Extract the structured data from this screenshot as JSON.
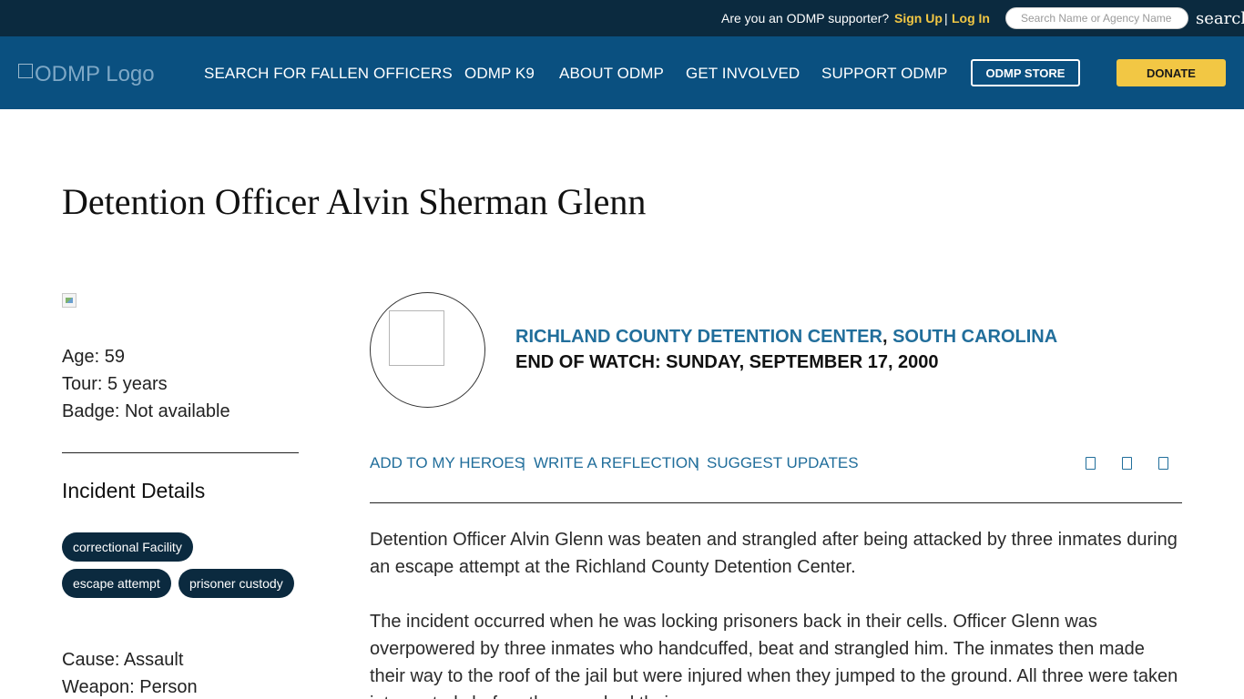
{
  "topbar": {
    "supporter_text": "Are you an ODMP supporter?",
    "signup_label": "Sign Up",
    "separator": "|",
    "login_label": "Log In",
    "search_placeholder": "Search Name or Agency Name",
    "search_button_label": "search"
  },
  "nav": {
    "logo_alt": "ODMP Logo",
    "items": [
      {
        "label": "SEARCH FOR FALLEN OFFICERS"
      },
      {
        "label": "ODMP K9"
      },
      {
        "label": "ABOUT ODMP"
      },
      {
        "label": "GET INVOLVED"
      },
      {
        "label": "SUPPORT ODMP"
      }
    ],
    "store_label": "ODMP STORE",
    "donate_label": "DONATE"
  },
  "officer": {
    "title": "Detention Officer Alvin Sherman Glenn",
    "age": "Age: 59",
    "tour": "Tour: 5 years",
    "badge": "Badge: Not available"
  },
  "incident": {
    "heading": "Incident Details",
    "tags": [
      "correctional Facility",
      "escape attempt",
      "prisoner custody"
    ],
    "cause": "Cause: Assault",
    "weapon": "Weapon: Person"
  },
  "agency": {
    "name": "RICHLAND COUNTY DETENTION CENTER",
    "comma": ",",
    "state": "SOUTH CAROLINA",
    "end_of_watch": "END OF WATCH: SUNDAY, SEPTEMBER 17, 2000"
  },
  "actions": {
    "add_heroes": "ADD TO MY HEROES",
    "write_reflection": "WRITE A REFLECTION",
    "suggest_updates": "SUGGEST UPDATES",
    "separator": "|"
  },
  "bio": {
    "paragraph1": "Detention Officer Alvin Glenn was beaten and strangled after being attacked by three inmates during an escape attempt at the Richland County Detention Center.",
    "paragraph2": "The incident occurred when he was locking prisoners back in their cells. Officer Glenn was overpowered by three inmates who handcuffed, beat and strangled him. The inmates then made their way to the roof of the jail but were injured when they jumped to the ground. All three were taken into custody before they reached their cars."
  },
  "colors": {
    "topbar_bg": "#0b2a3f",
    "nav_bg": "#0a5080",
    "accent_yellow": "#f2c744",
    "link_blue": "#216e9b",
    "tag_bg": "#0b2a3f"
  }
}
